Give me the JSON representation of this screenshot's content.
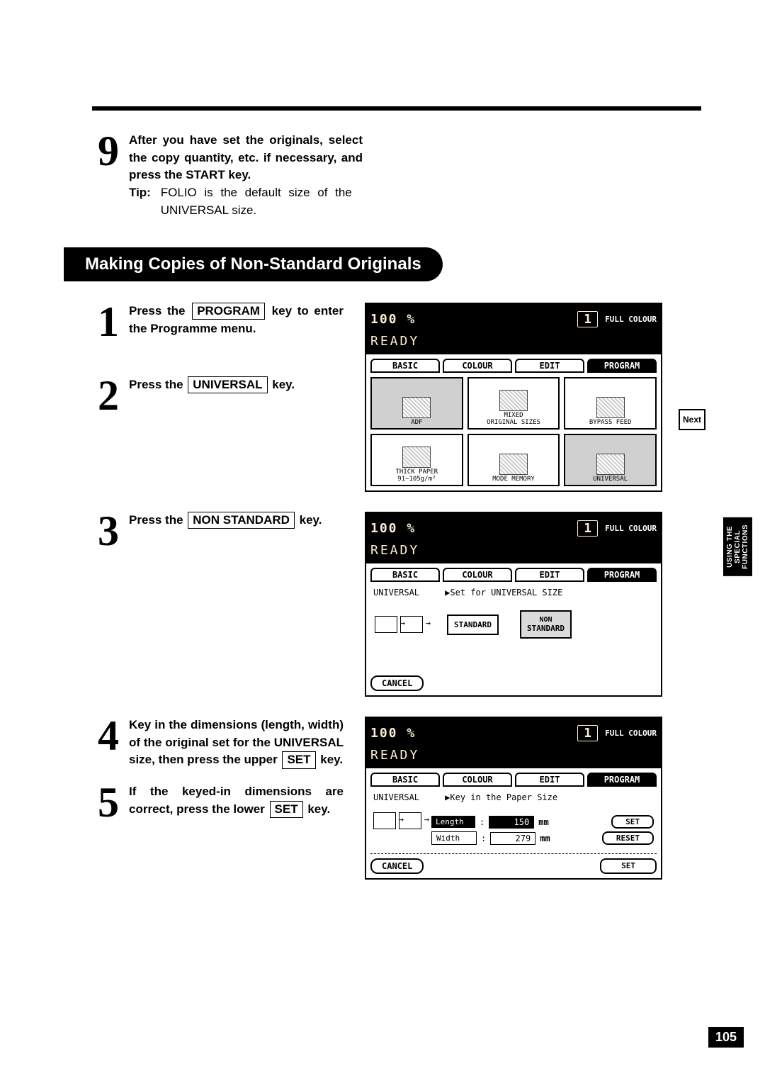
{
  "step9": {
    "text_part1": "After you have set the originals, select the copy quantity, etc. if necessary, and press the START key.",
    "tip_label": "Tip:",
    "tip_text": "FOLIO is the default size of the UNIVERSAL size."
  },
  "section_title": "Making Copies of Non-Standard Originals",
  "steps": {
    "s1": {
      "pre": "Press the",
      "key": "PROGRAM",
      "post": "key to enter the Programme menu."
    },
    "s2": {
      "pre": "Press the",
      "key": "UNIVERSAL",
      "post": "key."
    },
    "s3": {
      "pre": "Press the",
      "key": "NON STANDARD",
      "post": "key."
    },
    "s4": {
      "pre": "Key in the dimensions (length, width) of the original set for the UNIVERSAL size, then press the upper",
      "key": "SET",
      "post": "key."
    },
    "s5": {
      "pre": "If the keyed-in dimensions are correct, press the lower",
      "key": "SET",
      "post": "key."
    }
  },
  "lcd_common": {
    "percent": "100  %",
    "copies": "1",
    "full": "FULL COLOUR",
    "ready": "READY",
    "tabs": {
      "basic": "BASIC",
      "colour": "COLOUR",
      "edit": "EDIT",
      "program": "PROGRAM"
    }
  },
  "lcd1": {
    "cells": {
      "adf": "ADF",
      "mixed": "MIXED\nORIGINAL SIZES",
      "bypass": "BYPASS FEED",
      "thick": "THICK PAPER\n91~105g/m²",
      "mode": "MODE MEMORY",
      "universal": "UNIVERSAL"
    },
    "next": "Next"
  },
  "lcd2": {
    "subhead": "UNIVERSAL",
    "subtext": "▶Set for UNIVERSAL SIZE",
    "standard": "STANDARD",
    "nonstandard_l1": "NON",
    "nonstandard_l2": "STANDARD",
    "cancel": "CANCEL"
  },
  "lcd3": {
    "subhead": "UNIVERSAL",
    "subtext": "▶Key in the Paper Size",
    "length_label": "Length",
    "length_val": "150",
    "length_unit": "mm",
    "width_label": "Width",
    "width_val": "279",
    "width_unit": "mm",
    "set": "SET",
    "reset": "RESET",
    "cancel": "CANCEL",
    "set_lower": "SET",
    "colon": ":"
  },
  "side_tab": "USING THE\nSPECIAL\nFUNCTIONS",
  "page_number": "105"
}
